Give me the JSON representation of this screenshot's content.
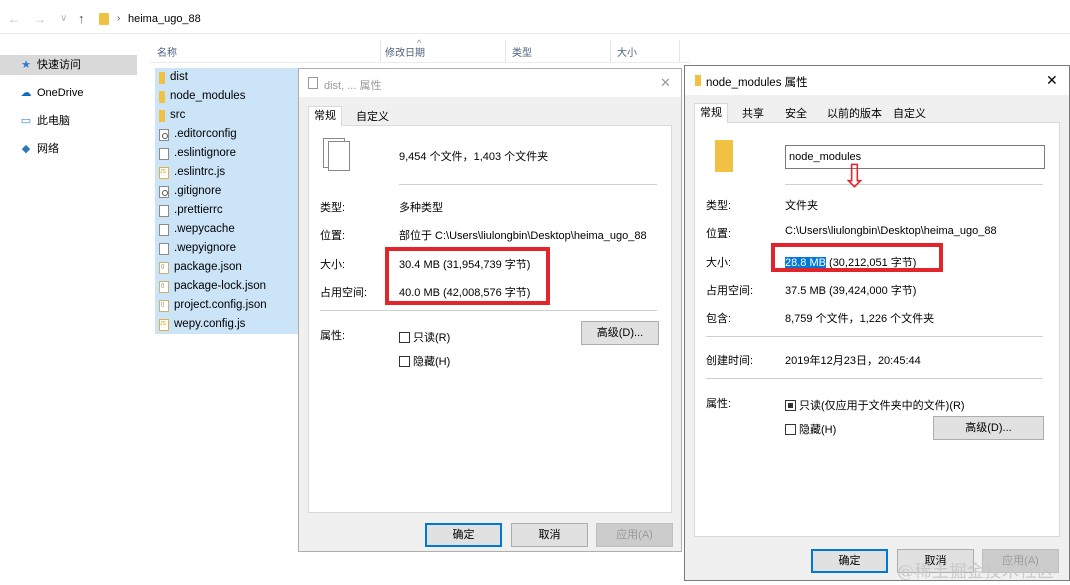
{
  "explorer": {
    "nav": {
      "back": "←",
      "forward": "→",
      "recent": "∨",
      "up": "↑",
      "sep": "›"
    },
    "path": "heima_ugo_88",
    "columns": {
      "name": "名称",
      "modified": "修改日期",
      "type": "类型",
      "size": "大小",
      "sort_caret": "^"
    },
    "sidebar": [
      {
        "label": "快速访问",
        "icon": "pin-icon",
        "glyph": "★",
        "color": "#2f7ad1"
      },
      {
        "label": "OneDrive",
        "icon": "cloud-icon",
        "glyph": "☁",
        "color": "#0f6cbd"
      },
      {
        "label": "此电脑",
        "icon": "computer-icon",
        "glyph": "▭",
        "color": "#3a8ad8"
      },
      {
        "label": "网络",
        "icon": "network-icon",
        "glyph": "◆",
        "color": "#2a7ab8"
      }
    ],
    "files": [
      {
        "name": "dist",
        "kind": "folder"
      },
      {
        "name": "node_modules",
        "kind": "folder"
      },
      {
        "name": "src",
        "kind": "folder"
      },
      {
        "name": ".editorconfig",
        "kind": "cfg"
      },
      {
        "name": ".eslintignore",
        "kind": "file"
      },
      {
        "name": ".eslintrc.js",
        "kind": "js"
      },
      {
        "name": ".gitignore",
        "kind": "cfg"
      },
      {
        "name": ".prettierrc",
        "kind": "file"
      },
      {
        "name": ".wepycache",
        "kind": "file"
      },
      {
        "name": ".wepyignore",
        "kind": "file"
      },
      {
        "name": "package.json",
        "kind": "json"
      },
      {
        "name": "package-lock.json",
        "kind": "json"
      },
      {
        "name": "project.config.json",
        "kind": "json"
      },
      {
        "name": "wepy.config.js",
        "kind": "js"
      }
    ]
  },
  "dialog1": {
    "title": "dist, ... 属性",
    "close": "✕",
    "tabs": [
      "常规",
      "自定义"
    ],
    "summary": "9,454 个文件，1,403 个文件夹",
    "type_label": "类型:",
    "type_value": "多种类型",
    "location_label": "位置:",
    "location_value": "部位于 C:\\Users\\liulongbin\\Desktop\\heima_ugo_88",
    "size_label": "大小:",
    "size_value": "30.4 MB (31,954,739 字节)",
    "disk_label": "占用空间:",
    "disk_value": "40.0 MB (42,008,576 字节)",
    "attr_label": "属性:",
    "readonly": "只读(R)",
    "hidden": "隐藏(H)",
    "advanced": "高级(D)...",
    "ok": "确定",
    "cancel": "取消",
    "apply": "应用(A)"
  },
  "dialog2": {
    "title": "node_modules 属性",
    "close": "✕",
    "tabs": [
      "常规",
      "共享",
      "安全",
      "以前的版本",
      "自定义"
    ],
    "name_value": "node_modules",
    "arrow": "⇩",
    "type_label": "类型:",
    "type_value": "文件夹",
    "location_label": "位置:",
    "location_value": "C:\\Users\\liulongbin\\Desktop\\heima_ugo_88",
    "size_label": "大小:",
    "size_highlight": "28.8 MB",
    "size_rest": "(30,212,051 字节)",
    "disk_label": "占用空间:",
    "disk_value": "37.5 MB (39,424,000 字节)",
    "contains_label": "包含:",
    "contains_value": "8,759 个文件，1,226 个文件夹",
    "created_label": "创建时间:",
    "created_value": "2019年12月23日，20:45:44",
    "attr_label": "属性:",
    "readonly": "只读(仅应用于文件夹中的文件)(R)",
    "hidden": "隐藏(H)",
    "advanced": "高级(D)...",
    "ok": "确定",
    "cancel": "取消",
    "apply": "应用(A)"
  },
  "watermark": "@稀土掘金技术社区",
  "colors": {
    "highlight_box": "#e1252a",
    "selection": "#cce4f7",
    "accent": "#0078d7"
  }
}
